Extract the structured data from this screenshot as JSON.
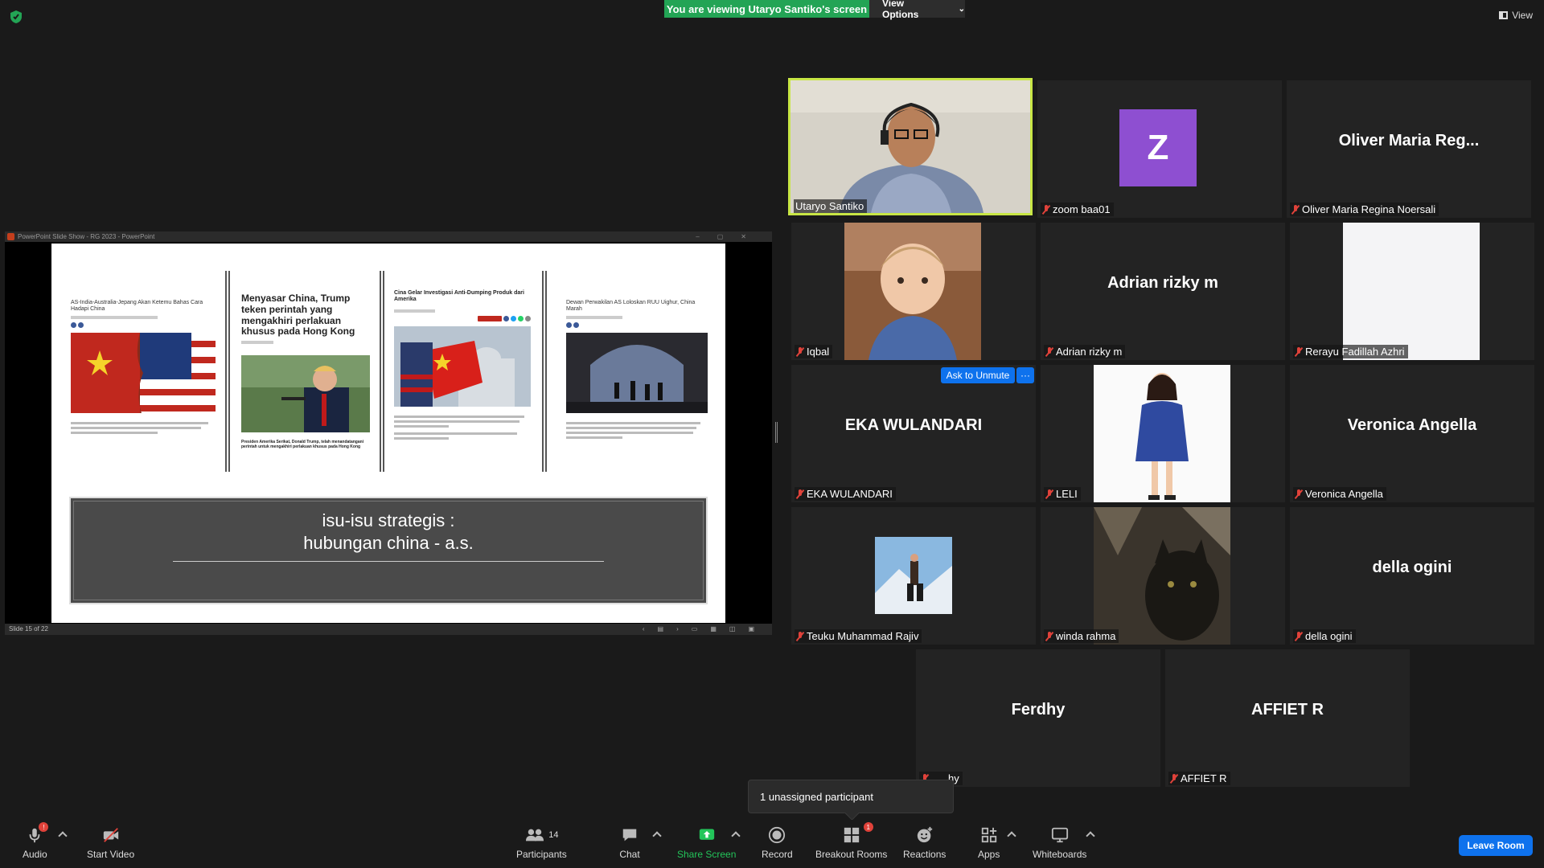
{
  "top": {
    "banner": "You are viewing Utaryo Santiko's screen",
    "view_options": "View Options",
    "view": "View"
  },
  "ppt": {
    "window_title": "PowerPoint Slide Show  -  RG 2023  -  PowerPoint",
    "status": "Slide 15 of 22",
    "articles": [
      "AS-India-Australia-Jepang Akan Ketemu Bahas Cara Hadapi China",
      "Menyasar China, Trump teken perintah yang mengakhiri perlakuan khusus pada Hong Kong",
      "Cina Gelar Investigasi Anti-Dumping Produk dari Amerika",
      "Dewan Perwakilan AS Loloskan RUU Uighur, China Marah"
    ],
    "caption_2": "Presiden Amerika Serikat, Donald Trump, telah menandatangani perintah untuk mengakhiri perlakuan khusus pada Hong Kong",
    "box_line1": "isu-isu strategis :",
    "box_line2": "hubungan china - a.s."
  },
  "participants": [
    {
      "name": "Utaryo Santiko",
      "big": ""
    },
    {
      "name": "zoom baa01",
      "big": "Z"
    },
    {
      "name": "Oliver Maria Regina Noersali",
      "big": "Oliver Maria Reg..."
    },
    {
      "name": "Iqbal",
      "big": ""
    },
    {
      "name": "Adrian rizky m",
      "big": "Adrian rizky m"
    },
    {
      "name": "Rerayu Fadillah Azhri",
      "big": ""
    },
    {
      "name": "EKA WULANDARI",
      "big": "EKA WULANDARI"
    },
    {
      "name": "LELI",
      "big": ""
    },
    {
      "name": "Veronica Angella",
      "big": "Veronica Angella"
    },
    {
      "name": "Teuku Muhammad Rajiv",
      "big": ""
    },
    {
      "name": "winda rahma",
      "big": ""
    },
    {
      "name": "della ogini",
      "big": "della ogini"
    },
    {
      "name": "hy",
      "big": "Ferdhy"
    },
    {
      "name": "AFFIET R",
      "big": "AFFIET R"
    }
  ],
  "ask_unmute": "Ask to Unmute",
  "more": "···",
  "tooltip": "1 unassigned participant",
  "toolbar": {
    "audio": "Audio",
    "audio_badge": "!",
    "start_video": "Start Video",
    "participants": "Participants",
    "participants_count": "14",
    "chat": "Chat",
    "share_screen": "Share Screen",
    "record": "Record",
    "breakout_rooms": "Breakout Rooms",
    "breakout_badge": "1",
    "reactions": "Reactions",
    "apps": "Apps",
    "whiteboards": "Whiteboards",
    "leave": "Leave Room"
  }
}
